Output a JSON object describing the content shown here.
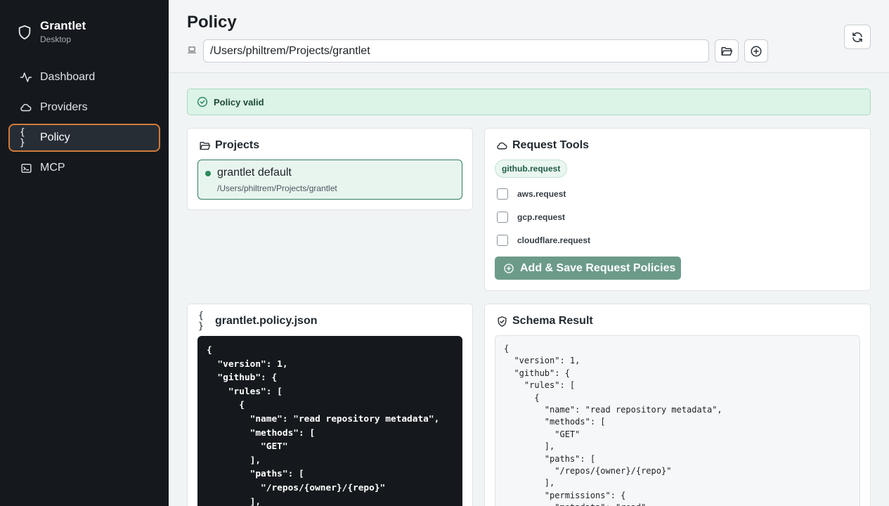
{
  "app": {
    "name": "Grantlet",
    "subtitle": "Desktop"
  },
  "sidebar": {
    "items": [
      {
        "label": "Dashboard",
        "icon": "activity-icon",
        "active": false
      },
      {
        "label": "Providers",
        "icon": "cloud-icon",
        "active": false
      },
      {
        "label": "Policy",
        "icon": "braces-icon",
        "active": true
      },
      {
        "label": "MCP",
        "icon": "terminal-icon",
        "active": false
      }
    ]
  },
  "header": {
    "title": "Policy",
    "path_value": "/Users/philtrem/Projects/grantlet"
  },
  "alert": {
    "text": "Policy valid",
    "color": "#dcf3e8"
  },
  "projects": {
    "title": "Projects",
    "items": [
      {
        "name": "grantlet default",
        "path": "/Users/philtrem/Projects/grantlet"
      }
    ]
  },
  "request_tools": {
    "title": "Request Tools",
    "tag": "github.request",
    "options": [
      "aws.request",
      "gcp.request",
      "cloudflare.request"
    ],
    "button_label": "Add & Save Request Policies"
  },
  "policy_file": {
    "title": "grantlet.policy.json",
    "code": "{\n  \"version\": 1,\n  \"github\": {\n    \"rules\": [\n      {\n        \"name\": \"read repository metadata\",\n        \"methods\": [\n          \"GET\"\n        ],\n        \"paths\": [\n          \"/repos/{owner}/{repo}\"\n        ],"
  },
  "schema_result": {
    "title": "Schema Result",
    "code": "{\n  \"version\": 1,\n  \"github\": {\n    \"rules\": [\n      {\n        \"name\": \"read repository metadata\",\n        \"methods\": [\n          \"GET\"\n        ],\n        \"paths\": [\n          \"/repos/{owner}/{repo}\"\n        ],\n        \"permissions\": {\n          \"metadata\": \"read\""
  },
  "colors": {
    "sidebar_bg": "#15191d",
    "accent": "#d27a3a",
    "success": "#2b8a5e",
    "primary_button": "#6c9b8a"
  }
}
